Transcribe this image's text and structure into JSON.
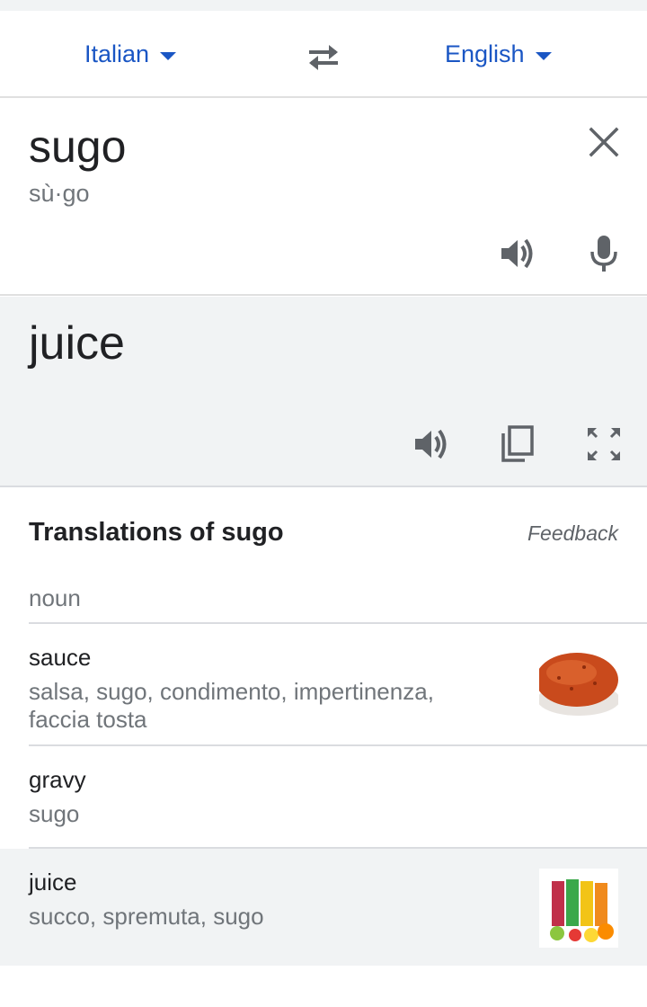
{
  "languages": {
    "source": "Italian",
    "target": "English"
  },
  "source": {
    "text": "sugo",
    "transliteration": "sù·go"
  },
  "translation": {
    "text": "juice"
  },
  "dictionary": {
    "title": "Translations of sugo",
    "feedback": "Feedback",
    "part_of_speech": "noun",
    "entries": [
      {
        "word": "sauce",
        "synonyms": "salsa, sugo, condimento, impertinenza, faccia tosta",
        "image": "sauce-image"
      },
      {
        "word": "gravy",
        "synonyms": "sugo"
      },
      {
        "word": "juice",
        "synonyms": "succo, spremuta, sugo",
        "image": "juice-image"
      }
    ]
  },
  "icons": {
    "swap": "swap-languages-icon",
    "clear": "close-icon",
    "speak_source": "speaker-icon",
    "mic": "microphone-icon",
    "speak_target": "speaker-icon",
    "copy": "copy-icon",
    "fullscreen": "fullscreen-icon"
  },
  "colors": {
    "accent": "#1a56c4",
    "icon": "#5f6368",
    "secondary_text": "#70757a",
    "result_bg": "#f1f3f4"
  }
}
